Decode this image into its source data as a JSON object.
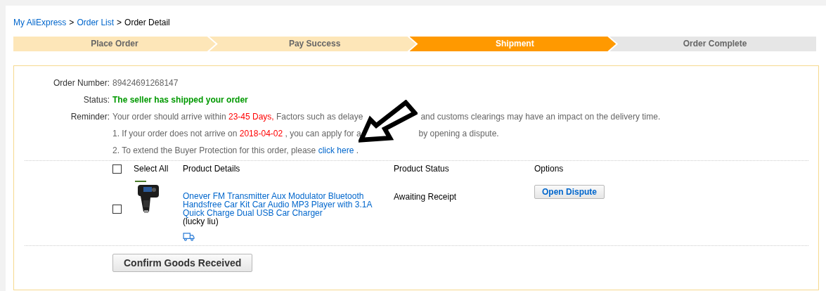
{
  "breadcrumb": [
    {
      "label": "My AliExpress",
      "kind": "link"
    },
    {
      "label": ">",
      "kind": "separator"
    },
    {
      "label": "Order List",
      "kind": "link"
    },
    {
      "label": ">",
      "kind": "separator"
    },
    {
      "label": "Order Detail",
      "kind": "current"
    }
  ],
  "steps": [
    {
      "label": "Place Order",
      "reached": true,
      "selected": false
    },
    {
      "label": "Pay Success",
      "reached": true,
      "selected": false
    },
    {
      "label": "Shipment",
      "reached": true,
      "selected": true
    },
    {
      "label": "Order Complete",
      "reached": false,
      "selected": false
    }
  ],
  "order": {
    "number_label": "Order Number:",
    "number": "89424691268147",
    "status_label": "Status:",
    "status": "The seller has shipped your order",
    "reminder_label": "Reminder:",
    "reminder_lines": [
      [
        [
          {
            "text": "Your order should arrive within ",
            "kind": "plain"
          },
          {
            "text": "23-45 Days,",
            "kind": "highlight"
          },
          {
            "text": " Factors such as delaye",
            "kind": "plain"
          }
        ],
        [
          {
            "text": "and customs clearings may have an impact on the delivery time.",
            "kind": "plain"
          }
        ]
      ],
      [
        [
          {
            "text": "1. If your order does not arrive on ",
            "kind": "plain"
          },
          {
            "text": "2018-04-02",
            "kind": "highlight"
          },
          {
            "text": " , you can apply for a",
            "kind": "plain"
          }
        ],
        [
          {
            "text": "by opening a dispute.",
            "kind": "plain"
          }
        ]
      ],
      [
        [
          {
            "text": "2. To extend the Buyer Protection for this order, please ",
            "kind": "plain"
          },
          {
            "text": "click here",
            "kind": "link"
          },
          {
            "text": " .",
            "kind": "plain"
          }
        ]
      ]
    ]
  },
  "table": {
    "select_all": {
      "label": "Select All",
      "checked": false
    },
    "columns": [
      "Product Details",
      "Product Status",
      "Options"
    ],
    "rows": [
      {
        "checked": false,
        "title": "Onever FM Transmitter Aux Modulator Bluetooth Handsfree Car Kit Car Audio MP3 Player with 3.1A Quick Charge Dual USB Car Charger",
        "seller": "(lucky liu)",
        "status": "Awaiting Receipt",
        "action": "Open Dispute"
      }
    ]
  },
  "confirm_button": "Confirm Goods Received"
}
